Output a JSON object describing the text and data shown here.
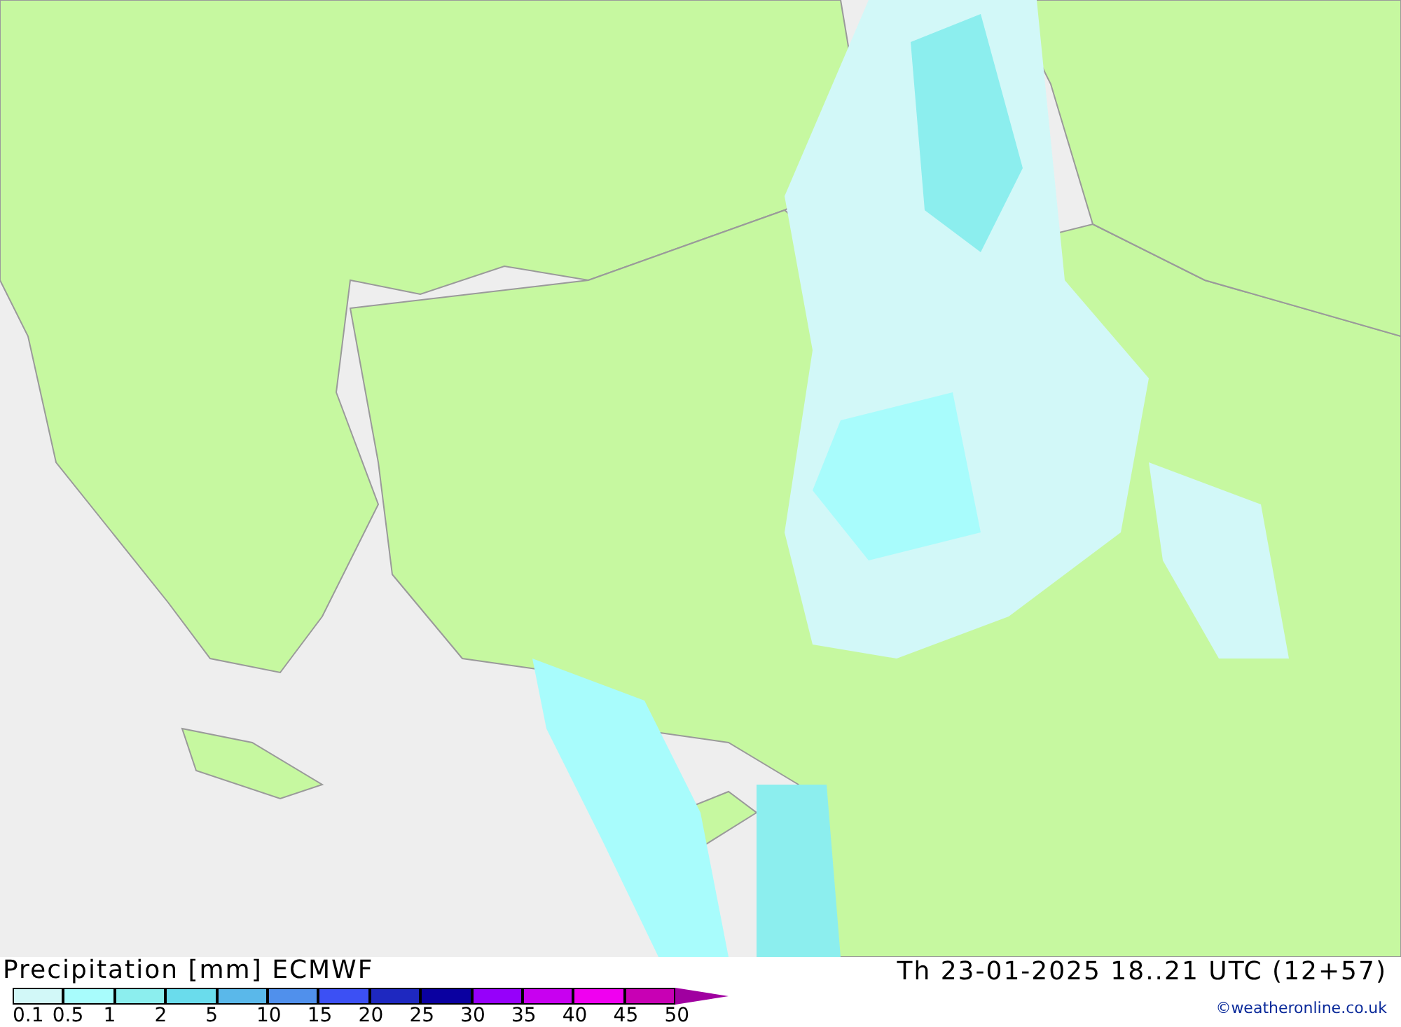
{
  "title": "Precipitation [mm] ECMWF",
  "valid_time": "Th 23-01-2025 18..21 UTC (12+57)",
  "legend": {
    "segments": [
      {
        "color": "#d2f8f8"
      },
      {
        "color": "#a8fcfc"
      },
      {
        "color": "#8ceeee"
      },
      {
        "color": "#6adcec"
      },
      {
        "color": "#5ab8ea"
      },
      {
        "color": "#5090ec"
      },
      {
        "color": "#3c50f4"
      },
      {
        "color": "#1e28c0"
      },
      {
        "color": "#0a00a0"
      },
      {
        "color": "#9600fa"
      },
      {
        "color": "#c800f0"
      },
      {
        "color": "#f000f0"
      },
      {
        "color": "#c800b4"
      }
    ],
    "labels": [
      "0.1",
      "0.5",
      "1",
      "2",
      "5",
      "10",
      "15",
      "20",
      "25",
      "30",
      "35",
      "40",
      "45",
      "50"
    ]
  },
  "credit": "©weatheronline.co.uk"
}
